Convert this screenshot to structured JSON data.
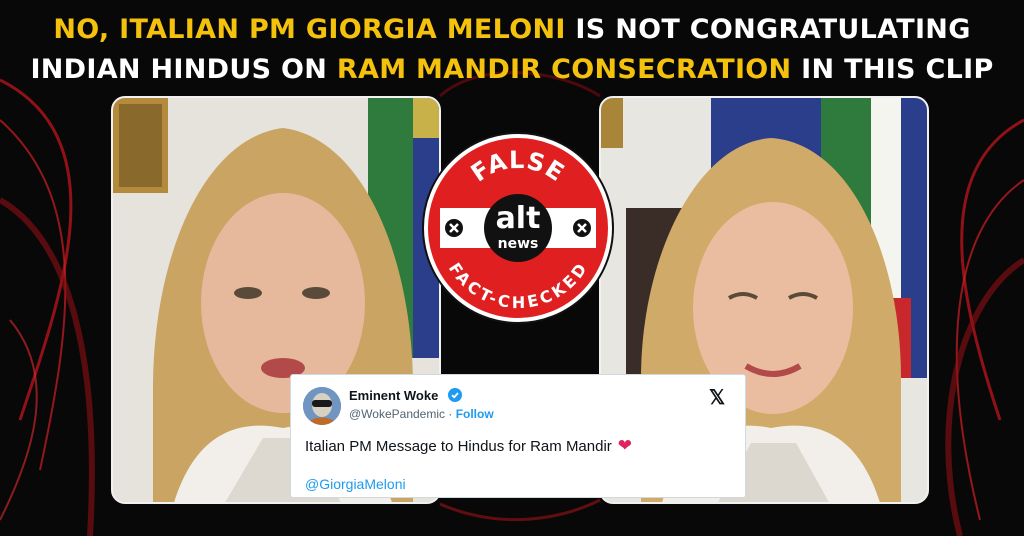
{
  "headline": {
    "line1": [
      {
        "text": "NO, ITALIAN PM GIORGIA MELONI",
        "highlight": true
      },
      {
        "text": " IS NOT CONGRATULATING",
        "highlight": false
      }
    ],
    "line2": [
      {
        "text": "INDIAN HINDUS ON ",
        "highlight": false
      },
      {
        "text": "RAM MANDIR CONSECRATION",
        "highlight": true
      },
      {
        "text": " IN THIS CLIP",
        "highlight": false
      }
    ]
  },
  "colors": {
    "highlight": "#f4c20d",
    "badge_red": "#e02020",
    "link_blue": "#1d9bf0",
    "heart": "#e0245e"
  },
  "badge": {
    "top_text": "FALSE",
    "logo_top": "alt",
    "logo_bottom": "news",
    "bottom_text": "FACT-CHECKED"
  },
  "tweet": {
    "name": "Eminent Woke",
    "handle": "@WokePandemic",
    "separator": "·",
    "follow": "Follow",
    "text": "Italian PM Message to Hindus for Ram Mandir",
    "emoji": "red-heart",
    "mention": "@GiorgiaMeloni",
    "platform_icon": "x-logo-icon",
    "verified_icon": "verified-badge-icon"
  }
}
